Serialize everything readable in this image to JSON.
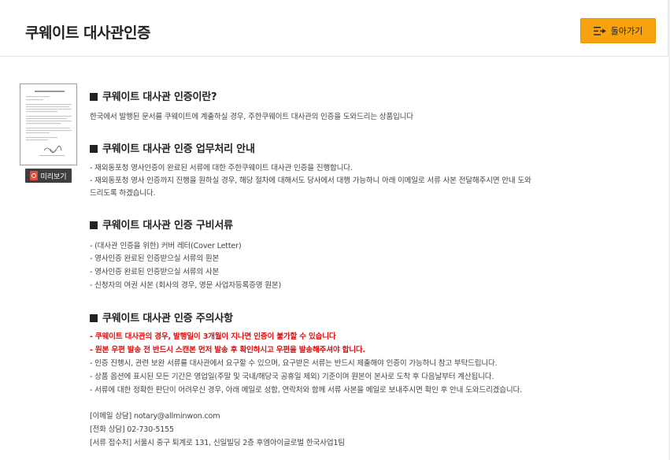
{
  "header": {
    "title": "쿠웨이트 대사관인증",
    "back_label": "돌아가기"
  },
  "sidebar": {
    "preview_label": "미리보기"
  },
  "sections": [
    {
      "title": "쿠웨이트 대사관 인증이란?",
      "lines": [
        "한국에서 발행된 문서를 쿠웨이트에 계출하실 경우, 주한쿠웨이트 대사관의 인증을 도와드리는 상품입니다"
      ]
    },
    {
      "title": "쿠웨이트 대사관 인증 업무처리 안내",
      "lines": [
        "- 재외동포청 영사인증이 완료된 서류에 대한 주한쿠웨이트 대사관 인증을 진행합니다.",
        "- 재외동포청 영사 인증까지 진행을 원하실 경우, 해당 절차에 대해서도 당사에서 대행 가능하니 아래 이메일로 서류 사본 전달해주시면 안내 도와",
        "드리도록 하겠습니다."
      ]
    },
    {
      "title": "쿠웨이트 대사관 인증 구비서류",
      "lines": [
        "- (대사관 인증을 위한) 커버 레터(Cover Letter)",
        "- 영사인증 완료된 인증받으실 서류의 원본",
        "- 영사인증 완료된 인증받으실 서류의 사본",
        "- 신청자의 여권 사본 (회사의 경우, 영문 사업자등록증명 원본)"
      ]
    },
    {
      "title": "쿠웨이트 대사관 인증 주의사항",
      "warnings": [
        "- 쿠웨이트 대사관의 경우, 발행일이 3개월이 지나면 인증이 불가할 수 있습니다",
        "- 원본 우편 발송 전 반드시 스캔본 먼저 발송 후 확인하시고 우편을 발송해주셔야 합니다."
      ],
      "lines": [
        "- 인증 진행시, 관련 보완 서류를 대사관에서 요구할 수 있으며, 요구받은 서류는 반드시 제출해야 인증이 가능하니 참고 부탁드립니다.",
        "- 상품 옵션에 표시된 모든 기간은 영업일(주말 및 국내/해당국 공휴일 제외) 기준이며 원본이 본사로 도착 후 다음날부터 계산됩니다.",
        "- 서류에 대한 정확한 판단이 어려우신 경우, 아래 메일로 성함, 연락처와 함께 서류 사본을 메일로 보내주시면 확인 후 안내 도와드리겠습니다."
      ]
    }
  ],
  "contact": {
    "email": "[이메일 상담] notary@allminwon.com",
    "phone": "[전화 상담] 02-730-5155",
    "address": "[서류 접수처] 서울시 중구 퇴계로 131, 신일빌딩 2층 후엠아이글로벌 한국사업1팀"
  },
  "colors": {
    "accent": "#f8a210",
    "warning": "#e20f0f"
  }
}
